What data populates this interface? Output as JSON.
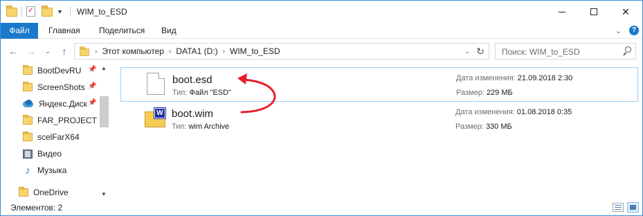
{
  "window": {
    "title": "WIM_to_ESD",
    "minimize_label": "—",
    "maximize_label": "☐",
    "close_label": "✕"
  },
  "quick_access_toolbar": {
    "dropdown_glyph": "▾"
  },
  "ribbon": {
    "tabs": [
      {
        "label": "Файл"
      },
      {
        "label": "Главная"
      },
      {
        "label": "Поделиться"
      },
      {
        "label": "Вид"
      }
    ],
    "collapse_glyph": "⌄",
    "help_glyph": "?"
  },
  "navigation": {
    "back_glyph": "←",
    "forward_glyph": "→",
    "recent_glyph": "⌄",
    "up_glyph": "↑",
    "breadcrumbs": [
      "Этот компьютер",
      "DATA1 (D:)",
      "WIM_to_ESD"
    ],
    "breadcrumb_separator": "›",
    "address_dropdown_glyph": "⌄",
    "refresh_glyph": "↻"
  },
  "search": {
    "placeholder": "Поиск: WIM_to_ESD"
  },
  "sidebar": {
    "pin_glyph": "📌",
    "items": [
      {
        "label": "BootDevRU",
        "icon": "folder-icon",
        "pinned": true
      },
      {
        "label": "ScreenShots",
        "icon": "folder-icon",
        "pinned": true
      },
      {
        "label": "Яндекс.Диск",
        "icon": "yandex-disk-icon",
        "pinned": true
      },
      {
        "label": "FAR_PROJECT",
        "icon": "folder-icon",
        "pinned": false
      },
      {
        "label": "scelFarX64",
        "icon": "folder-icon",
        "pinned": false
      },
      {
        "label": "Видео",
        "icon": "video-icon",
        "pinned": false
      },
      {
        "label": "Музыка",
        "icon": "music-icon",
        "pinned": false
      },
      {
        "label": "OneDrive",
        "icon": "folder-icon",
        "pinned": false
      }
    ],
    "scroll_up_glyph": "▲",
    "scroll_down_glyph": "▼"
  },
  "files": [
    {
      "name": "boot.esd",
      "type_key": "Тип:",
      "type_value": "Файл \"ESD\"",
      "modified_key": "Дата изменения:",
      "modified_value": "21.09.2018 2:30",
      "size_key": "Размер:",
      "size_value": "229 МБ",
      "icon": "document-icon",
      "selected": true
    },
    {
      "name": "boot.wim",
      "type_key": "Тип:",
      "type_value": "wim Archive",
      "modified_key": "Дата изменения:",
      "modified_value": "01.08.2018 0:35",
      "size_key": "Размер:",
      "size_value": "330 МБ",
      "icon": "wim-archive-icon",
      "icon_badge": "W",
      "selected": false
    }
  ],
  "annotation": {
    "arrow_color": "#e8202a",
    "from": "boot.wim",
    "to": "boot.esd"
  },
  "statusbar": {
    "text": "Элементов: 2"
  },
  "colors": {
    "accent": "#1979ca",
    "selection_border": "#99d1ff"
  }
}
